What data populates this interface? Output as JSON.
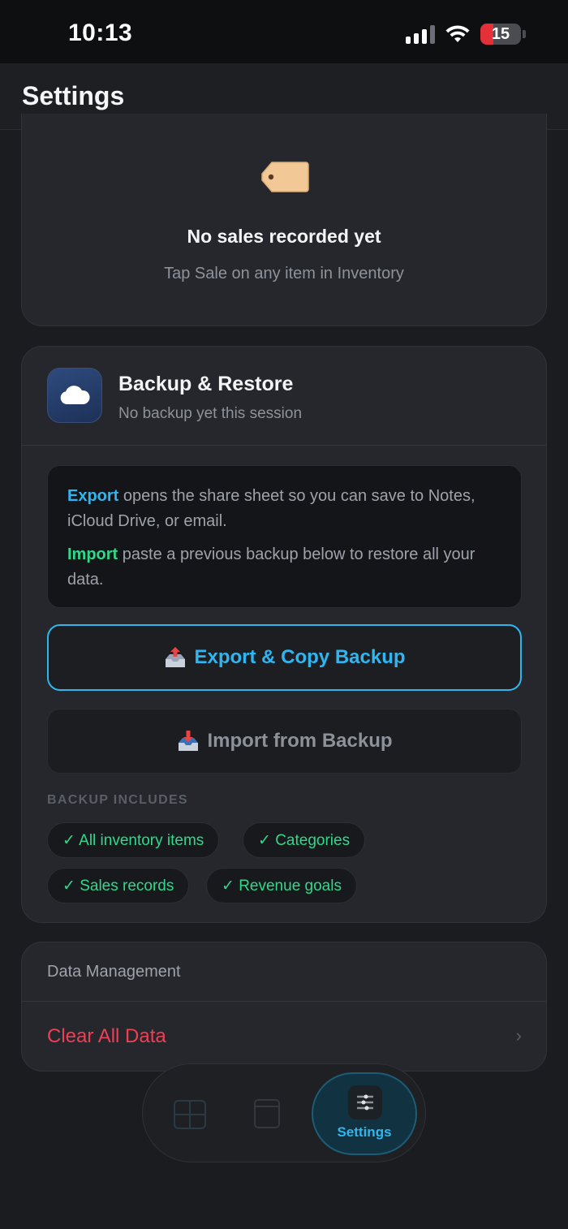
{
  "status_bar": {
    "time": "10:13",
    "battery_level": "15"
  },
  "nav": {
    "title": "Settings"
  },
  "sales": {
    "icon": "price-tag-icon",
    "title": "No sales recorded yet",
    "subtitle": "Tap Sale on any item in Inventory"
  },
  "backup": {
    "icon": "cloud-icon",
    "title": "Backup & Restore",
    "subtitle": "No backup yet this session",
    "info": {
      "export_keyword": "Export",
      "export_text": " opens the share sheet so you can save to Notes, iCloud Drive, or email.",
      "import_keyword": "Import",
      "import_text": " paste a previous backup below to restore all your data."
    },
    "export_button": "Export & Copy Backup",
    "import_button": "Import from Backup",
    "includes_label": "BACKUP INCLUDES",
    "includes": [
      "✓ All inventory items",
      "✓ Categories",
      "✓ Sales records",
      "✓ Revenue goals"
    ]
  },
  "data_management": {
    "title": "Data Management",
    "clear_label": "Clear All Data",
    "chevron": "›"
  },
  "tabbar": {
    "tabs": [
      {
        "icon": "grid-icon",
        "label": ""
      },
      {
        "icon": "document-icon",
        "label": ""
      },
      {
        "icon": "sliders-icon",
        "label": "Settings",
        "active": true
      }
    ]
  },
  "colors": {
    "accent_blue": "#2fb6f0",
    "accent_green": "#2fd98a",
    "danger_red": "#ef3f55"
  }
}
